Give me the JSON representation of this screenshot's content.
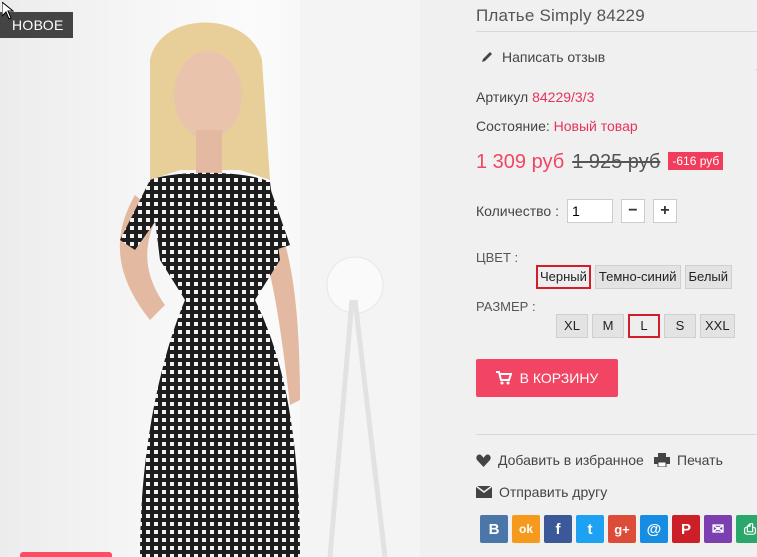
{
  "badge": {
    "new_label": "НОВОЕ"
  },
  "product": {
    "title": "Платье Simply 84229",
    "write_review": "Написать отзыв",
    "article_label": "Артикул",
    "article_value": "84229/3/3",
    "condition_label": "Состояние:",
    "condition_value": "Новый товар",
    "price": "1 309 руб",
    "old_price": "1 925 руб",
    "discount": "-616 руб",
    "quantity_label": "Количество :",
    "quantity_value": "1",
    "minus": "−",
    "plus": "+"
  },
  "color": {
    "label": "ЦВЕТ :",
    "options": [
      "Черный",
      "Темно-синий",
      "Белый"
    ],
    "selected": "Черный"
  },
  "size": {
    "label": "РАЗМЕР :",
    "options": [
      "XL",
      "M",
      "L",
      "S",
      "XXL"
    ],
    "selected": "L"
  },
  "cart": {
    "label": "В КОРЗИНУ"
  },
  "actions": {
    "wishlist": "Добавить в избранное",
    "print": "Печать",
    "send_friend": "Отправить другу"
  },
  "social": [
    {
      "name": "vk-icon",
      "glyph": "B",
      "color": "#4a76a8"
    },
    {
      "name": "odnoklassniki-icon",
      "glyph": "ok",
      "color": "#f59a1d"
    },
    {
      "name": "facebook-icon",
      "glyph": "f",
      "color": "#3b5998"
    },
    {
      "name": "twitter-icon",
      "glyph": "t",
      "color": "#1da1f2"
    },
    {
      "name": "googleplus-icon",
      "glyph": "g+",
      "color": "#dd4b39"
    },
    {
      "name": "mailru-icon",
      "glyph": "@",
      "color": "#168de2"
    },
    {
      "name": "pinterest-icon",
      "glyph": "P",
      "color": "#cb2027"
    },
    {
      "name": "email-icon",
      "glyph": "✉",
      "color": "#7b3fb0"
    },
    {
      "name": "print-share-icon",
      "glyph": "⎙",
      "color": "#2aa86b"
    }
  ],
  "colors": {
    "accent": "#f24563",
    "selected_border": "#d51c2a",
    "link": "#e5335a"
  }
}
